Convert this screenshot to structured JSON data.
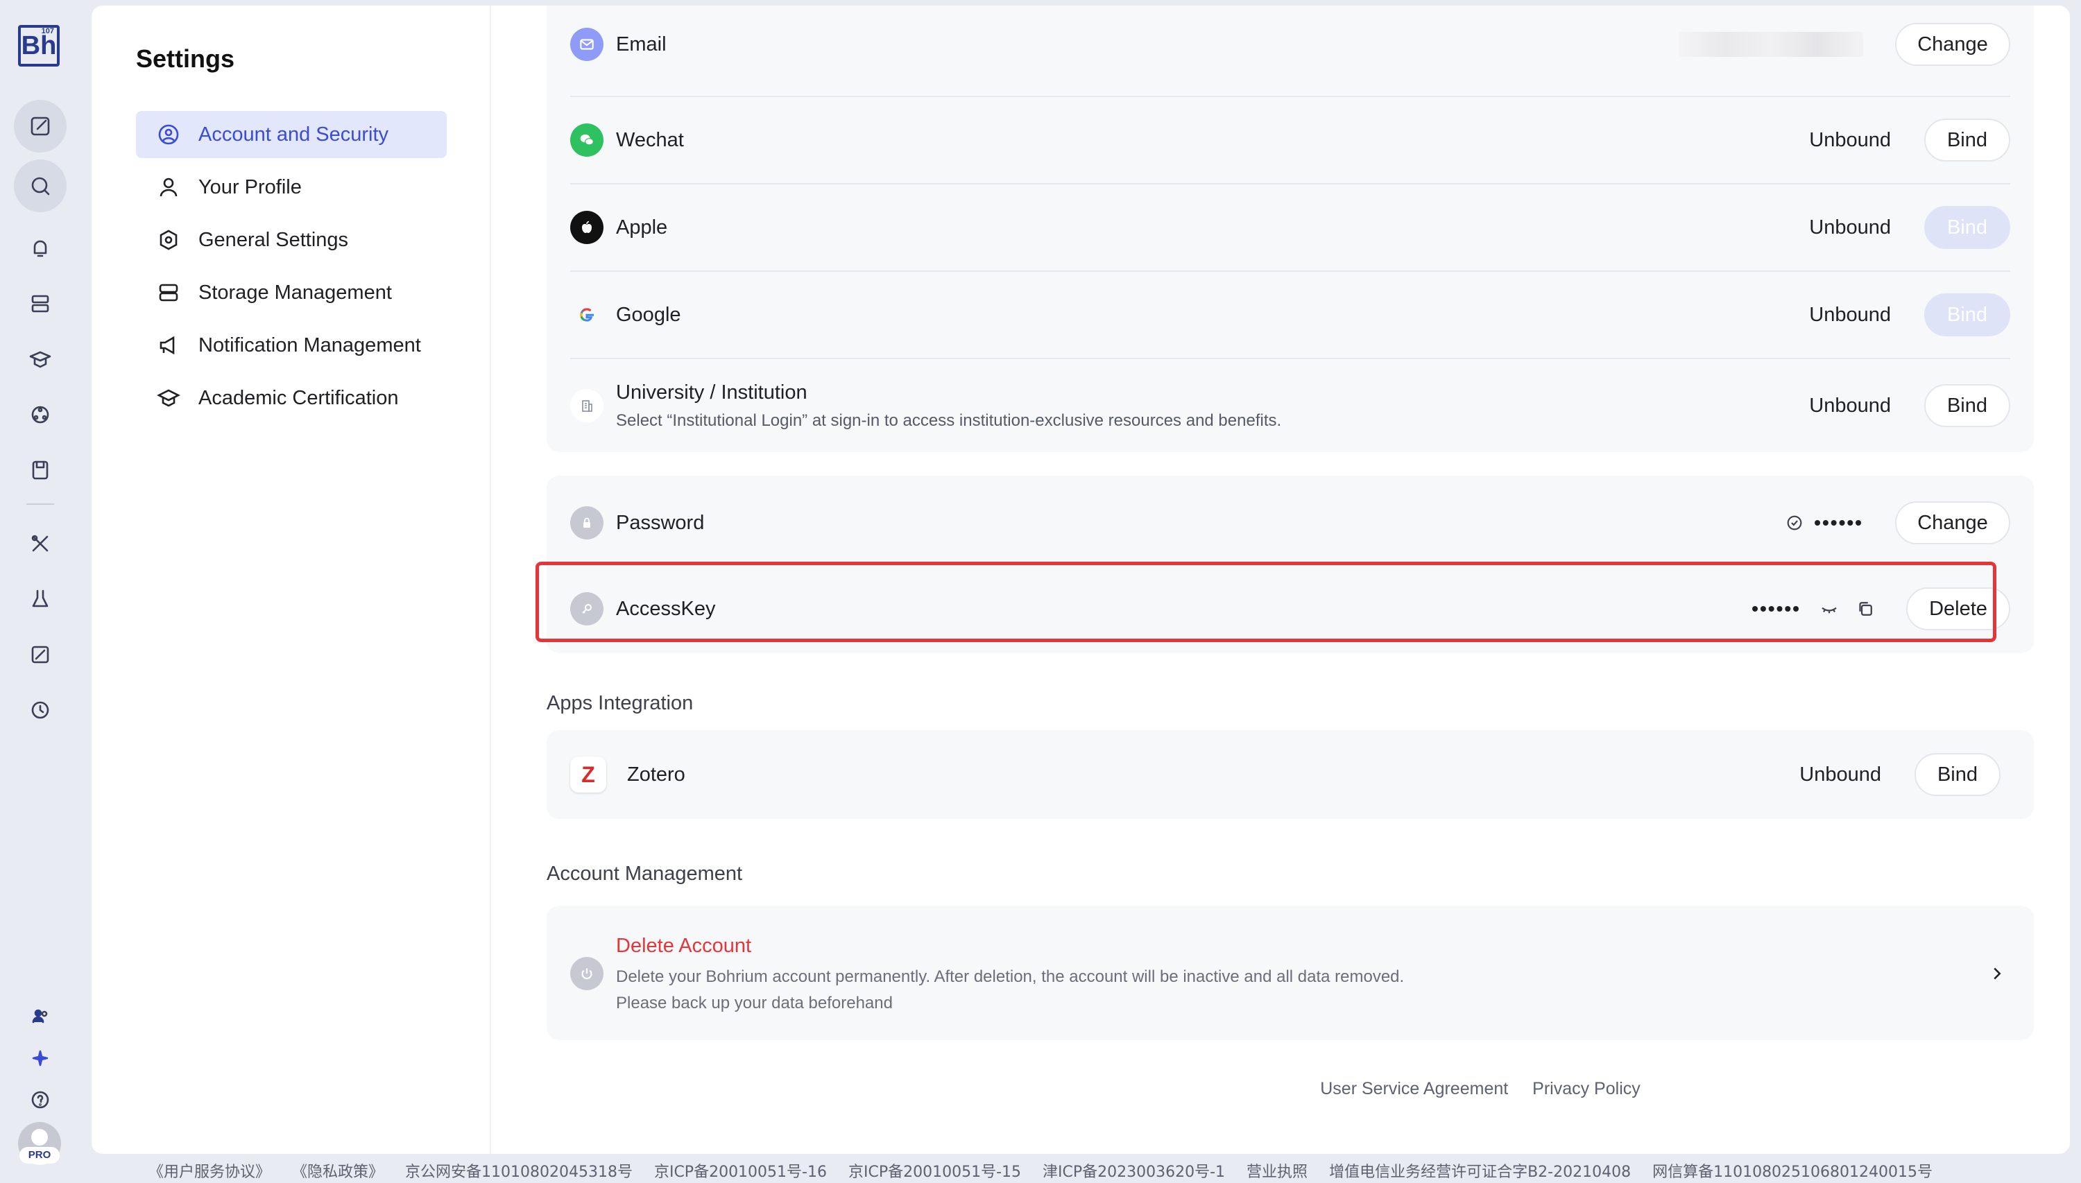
{
  "app": {
    "logo_text": "Bh",
    "logo_superscript": "107",
    "pro_badge": "PRO"
  },
  "sidebar": {
    "title": "Settings",
    "items": [
      {
        "label": "Account and Security",
        "icon": "user-circle-icon",
        "active": true
      },
      {
        "label": "Your Profile",
        "icon": "person-icon"
      },
      {
        "label": "General Settings",
        "icon": "settings-hex-icon"
      },
      {
        "label": "Storage Management",
        "icon": "storage-icon"
      },
      {
        "label": "Notification Management",
        "icon": "megaphone-icon"
      },
      {
        "label": "Academic Certification",
        "icon": "graduation-cap-icon"
      }
    ]
  },
  "bindings": {
    "rows": [
      {
        "label": "Email",
        "status": "",
        "action": "Change",
        "icon": "mail-icon",
        "icon_color": "#8e9cf8"
      },
      {
        "label": "Wechat",
        "status": "Unbound",
        "action": "Bind",
        "icon": "wechat-icon",
        "icon_color": "#2dc160"
      },
      {
        "label": "Apple",
        "status": "Unbound",
        "action": "Bind",
        "disabled": true,
        "icon": "apple-icon",
        "icon_color": "#111111"
      },
      {
        "label": "Google",
        "status": "Unbound",
        "action": "Bind",
        "disabled": true,
        "icon": "google-icon",
        "icon_color": "#4285f4"
      },
      {
        "label": "University / Institution",
        "sub": "Select “Institutional Login” at sign-in to access institution-exclusive resources and benefits.",
        "status": "Unbound",
        "action": "Bind",
        "icon": "building-icon"
      }
    ]
  },
  "security": {
    "password": {
      "label": "Password",
      "masked": "••••••",
      "action": "Change"
    },
    "accesskey": {
      "label": "AccessKey",
      "masked": "••••••",
      "action": "Delete"
    }
  },
  "apps_integration": {
    "title": "Apps Integration",
    "zotero": {
      "label": "Zotero",
      "status": "Unbound",
      "action": "Bind",
      "icon_letter": "Z"
    }
  },
  "account_management": {
    "title": "Account Management",
    "delete": {
      "title": "Delete Account",
      "line1": "Delete your Bohrium account permanently. After deletion, the account will be inactive and all data removed.",
      "line2": "Please back up your data beforehand"
    }
  },
  "footer": {
    "agreement": "User Service Agreement",
    "privacy": "Privacy Policy"
  },
  "icp": [
    "《用户服务协议》",
    "《隐私政策》",
    "京公网安备11010802045318号",
    "京ICP备20010051号-16",
    "京ICP备20010051号-15",
    "津ICP备2023003620号-1",
    "营业执照",
    "增值电信业务经营许可证合字B2-20210408",
    "网信算备110108025106801240015号"
  ],
  "colors": {
    "accent": "#3a4bd6",
    "danger": "#e6353a",
    "active_bg": "#e3e7fb"
  }
}
